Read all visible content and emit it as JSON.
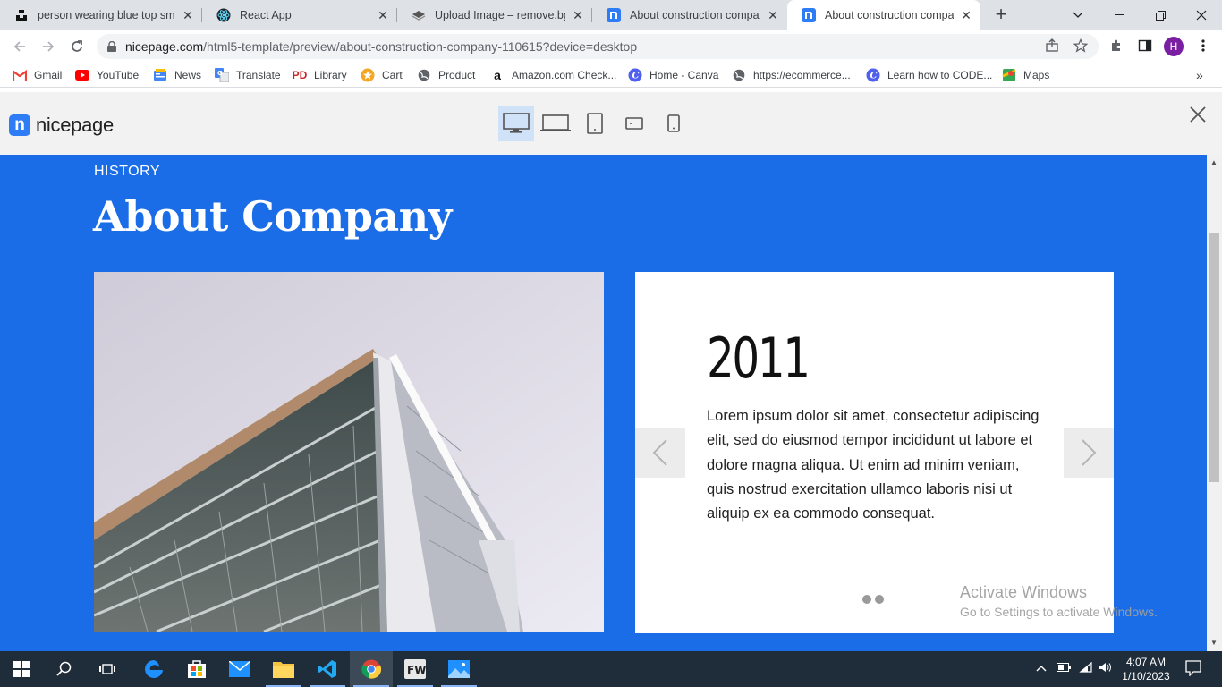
{
  "tabs": [
    {
      "title": "person wearing blue top smil",
      "icon": "unsplash-icon"
    },
    {
      "title": "React App",
      "icon": "react-icon"
    },
    {
      "title": "Upload Image – remove.bg",
      "icon": "removebg-icon"
    },
    {
      "title": "About construction company",
      "icon": "nicepage-icon"
    },
    {
      "title": "About construction company",
      "icon": "nicepage-icon",
      "active": true
    }
  ],
  "address": {
    "host": "nicepage.com",
    "path": "/html5-template/preview/about-construction-company-110615?device=desktop"
  },
  "profile_initial": "H",
  "bookmarks": [
    {
      "label": "Gmail",
      "icon": "gmail-icon"
    },
    {
      "label": "YouTube",
      "icon": "youtube-icon"
    },
    {
      "label": "News",
      "icon": "news-icon"
    },
    {
      "label": "Translate",
      "icon": "translate-icon"
    },
    {
      "label": "Library",
      "icon": "library-icon"
    },
    {
      "label": "Cart",
      "icon": "cart-icon"
    },
    {
      "label": "Product",
      "icon": "globe-icon"
    },
    {
      "label": "Amazon.com Check...",
      "icon": "amazon-icon"
    },
    {
      "label": "Home - Canva",
      "icon": "canva-icon"
    },
    {
      "label": "https://ecommerce...",
      "icon": "globe-icon"
    },
    {
      "label": "Learn how to CODE...",
      "icon": "canva-icon"
    },
    {
      "label": "Maps",
      "icon": "maps-icon"
    }
  ],
  "preview": {
    "logo_text": "nicepage",
    "logo_mark": "n",
    "devices": [
      "desktop",
      "laptop",
      "tablet",
      "tablet-landscape",
      "phone"
    ],
    "selected_device": "desktop"
  },
  "section": {
    "eyebrow": "HISTORY",
    "heading": "About Company",
    "slide": {
      "year": "2011",
      "text": "Lorem ipsum dolor sit amet, consectetur adipiscing elit, sed do eiusmod tempor incididunt ut labore et dolore magna aliqua. Ut enim ad minim veniam, quis nostrud exercitation ullamco laboris nisi ut aliquip ex ea commodo consequat.",
      "slide_count": 2
    }
  },
  "watermark": {
    "line1": "Activate Windows",
    "line2": "Go to Settings to activate Windows."
  },
  "clock": {
    "time": "4:07 AM",
    "date": "1/10/2023"
  },
  "colors": {
    "accent": "#1a6de6",
    "nicepage": "#2f7df6",
    "taskbar": "#1f2d3a"
  }
}
